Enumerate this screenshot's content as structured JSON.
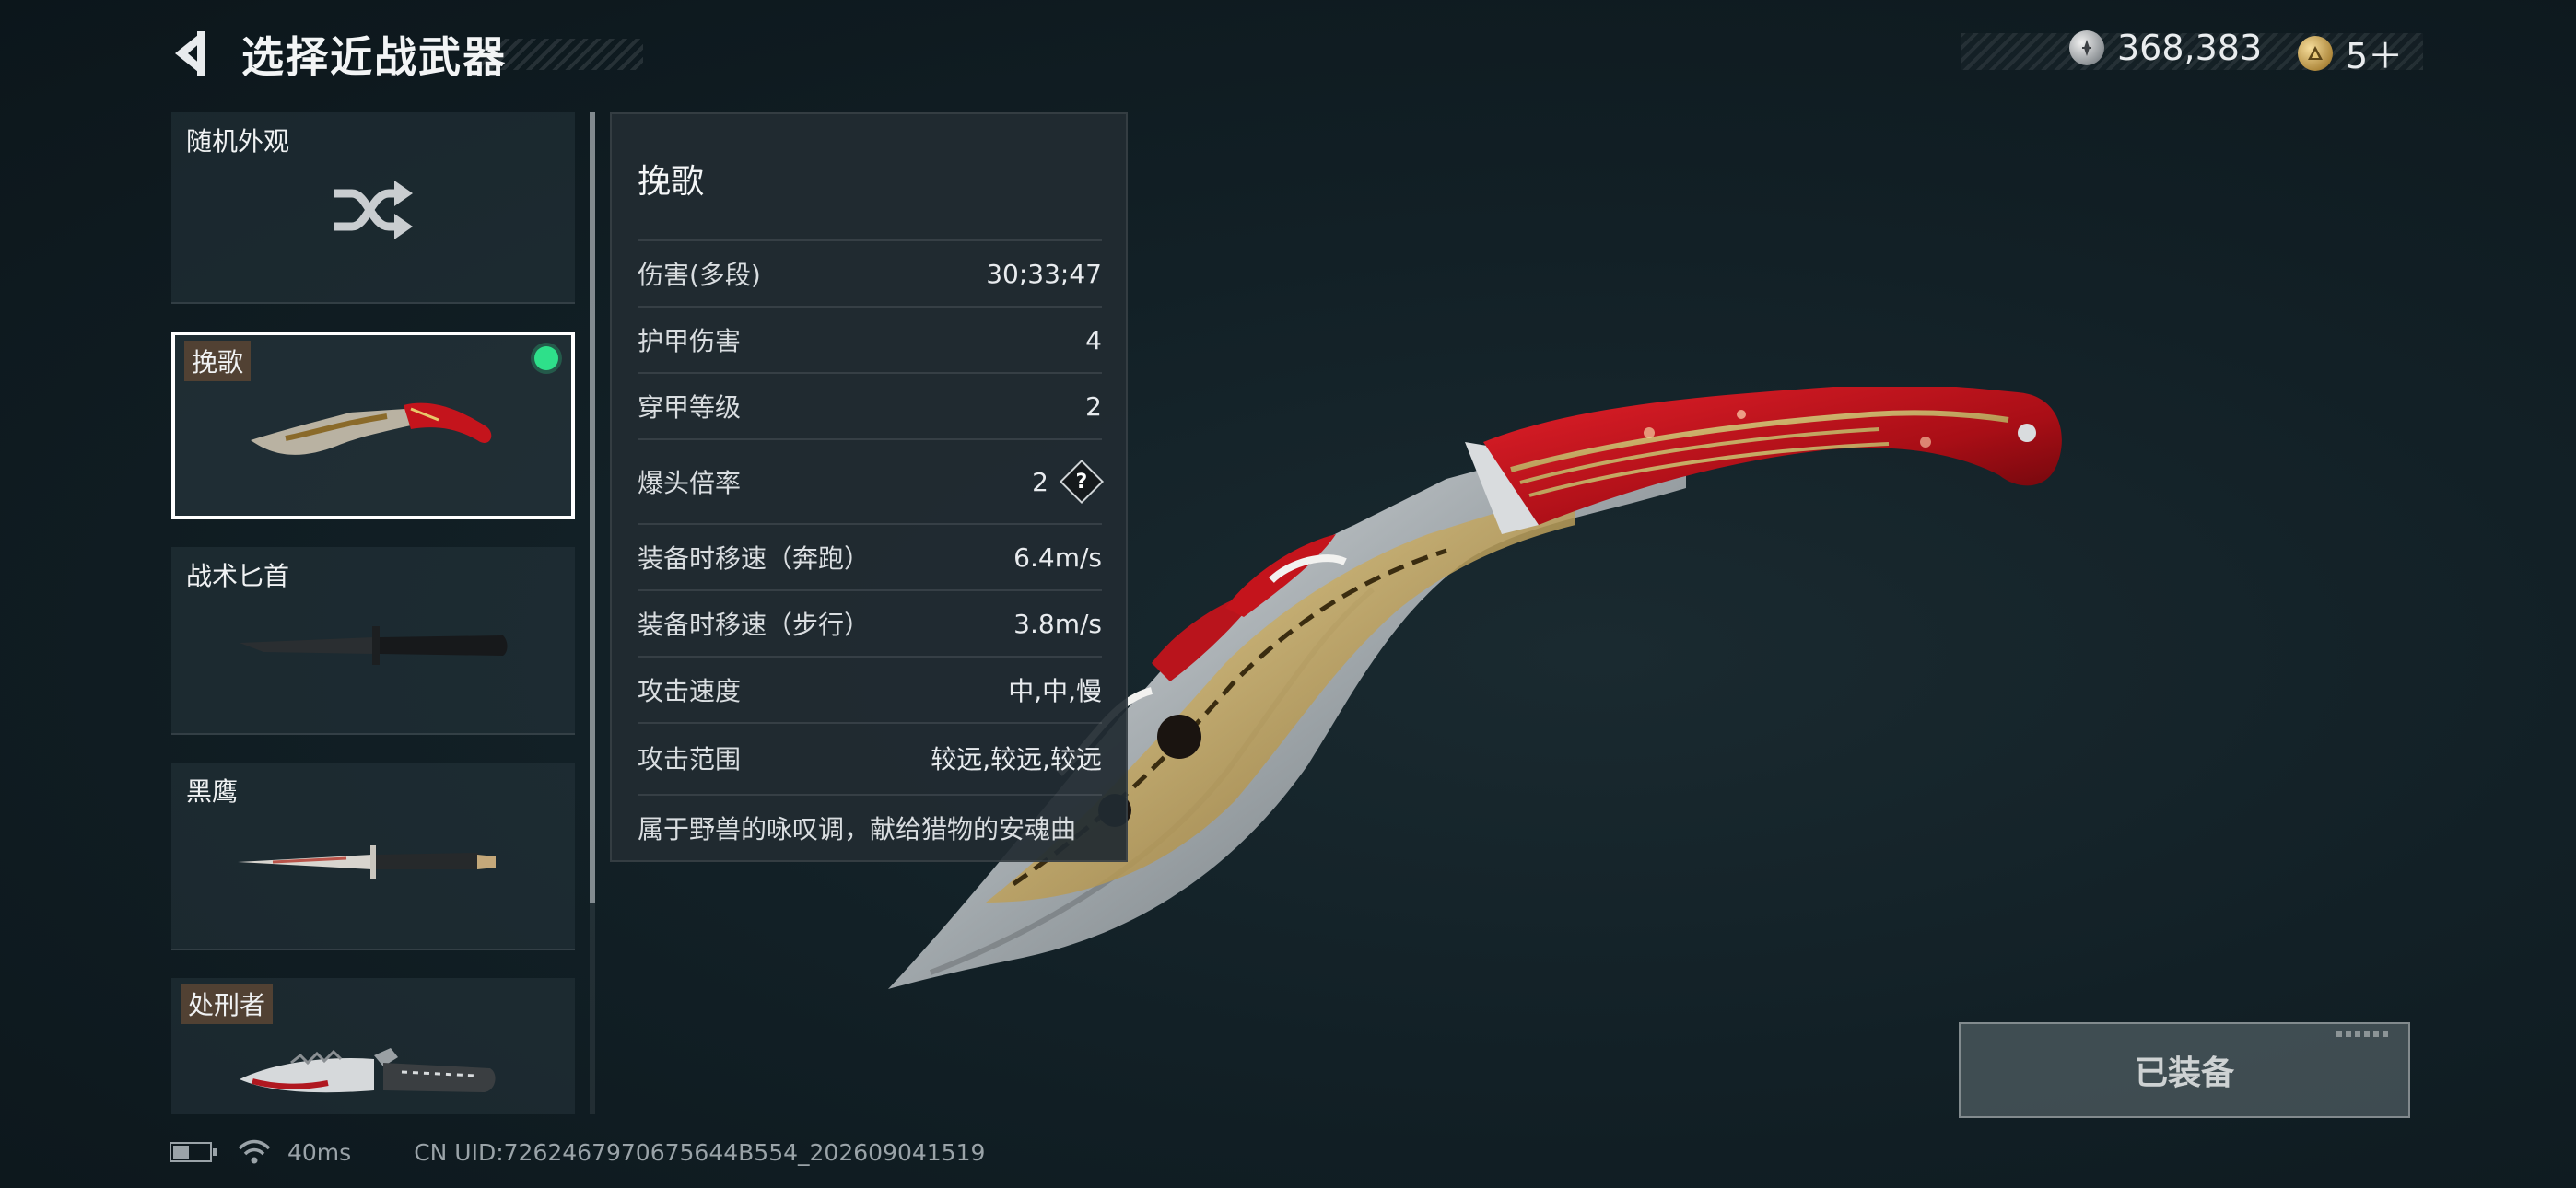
{
  "header": {
    "title": "选择近战武器",
    "back_icon": "back-arrow-icon"
  },
  "currency": {
    "silver_icon": "silver-coin-icon",
    "silver_amount": "368,383",
    "gold_icon": "gold-coin-icon",
    "gold_amount": "5＋"
  },
  "weapon_list": [
    {
      "label": "随机外观",
      "icon": "shuffle-icon",
      "selected": false
    },
    {
      "label": "挽歌",
      "icon": "kukri-knife-icon",
      "selected": true,
      "equipped": true
    },
    {
      "label": "战术匕首",
      "icon": "tactical-knife-icon",
      "selected": false
    },
    {
      "label": "黑鹰",
      "icon": "dagger-icon",
      "selected": false
    },
    {
      "label": "处刑者",
      "icon": "serrated-knife-icon",
      "selected": false
    }
  ],
  "detail": {
    "title": "挽歌",
    "stats": [
      {
        "label": "伤害(多段)",
        "value": "30;33;47"
      },
      {
        "label": "护甲伤害",
        "value": "4"
      },
      {
        "label": "穿甲等级",
        "value": "2"
      },
      {
        "label": "爆头倍率",
        "value": "2",
        "help": "?"
      },
      {
        "label": "装备时移速（奔跑）",
        "value": "6.4m/s"
      },
      {
        "label": "装备时移速（步行）",
        "value": "3.8m/s"
      },
      {
        "label": "攻击速度",
        "value": "中,中,慢"
      },
      {
        "label": "攻击范围",
        "value": "较远,较远,较远"
      }
    ],
    "flavor": "属于野兽的咏叹调，献给猎物的安魂曲"
  },
  "equip_button": {
    "label": "已装备"
  },
  "status_bar": {
    "battery_icon": "battery-icon",
    "battery_level": 0.45,
    "wifi_icon": "wifi-icon",
    "ping": "40ms",
    "uid": "CN UID:7262467970675644B554_202609041519"
  },
  "colors": {
    "accent_green": "#2ee08a",
    "blade_red": "#c0141c",
    "gold": "#c8a451"
  }
}
